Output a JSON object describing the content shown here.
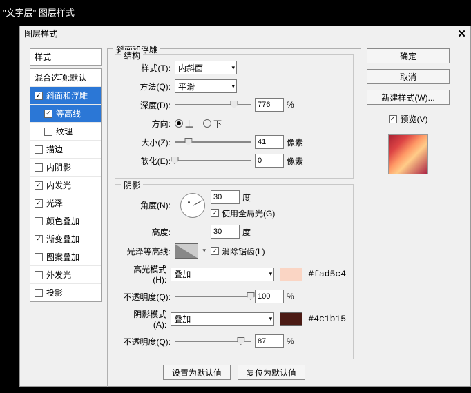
{
  "outer_title": "\"文字层\" 图层样式",
  "dialog": {
    "title": "图层样式",
    "close": "✕"
  },
  "left": {
    "styles_header": "样式",
    "blend_options": "混合选项:默认",
    "bevel": "斜面和浮雕",
    "contour": "等高线",
    "texture": "纹理",
    "stroke": "描边",
    "inner_shadow": "内阴影",
    "inner_glow": "内发光",
    "satin": "光泽",
    "color_overlay": "颜色叠加",
    "gradient_overlay": "渐变叠加",
    "pattern_overlay": "图案叠加",
    "outer_glow": "外发光",
    "drop_shadow": "投影"
  },
  "bevel": {
    "section": "斜面和浮雕",
    "structure_legend": "结构",
    "style_label": "样式(T):",
    "style_value": "内斜面",
    "technique_label": "方法(Q):",
    "technique_value": "平滑",
    "depth_label": "深度(D):",
    "depth_value": "776",
    "percent": "%",
    "direction_label": "方向:",
    "dir_up": "上",
    "dir_down": "下",
    "size_label": "大小(Z):",
    "size_value": "41",
    "px": "像素",
    "soften_label": "软化(E):",
    "soften_value": "0"
  },
  "shading": {
    "legend": "阴影",
    "angle_label": "角度(N):",
    "angle_value": "30",
    "deg": "度",
    "global_light": "使用全局光(G)",
    "altitude_label": "高度:",
    "altitude_value": "30",
    "gloss_contour_label": "光泽等高线:",
    "antialias": "消除锯齿(L)",
    "highlight_mode_label": "高光模式(H):",
    "highlight_mode_value": "叠加",
    "highlight_opacity_label": "不透明度(Q):",
    "highlight_opacity_value": "100",
    "highlight_hex": "#fad5c4",
    "shadow_mode_label": "阴影模式(A):",
    "shadow_mode_value": "叠加",
    "shadow_opacity_label": "不透明度(Q):",
    "shadow_opacity_value": "87",
    "shadow_hex": "#4c1b15"
  },
  "footer": {
    "make_default": "设置为默认值",
    "reset_default": "复位为默认值"
  },
  "right": {
    "ok": "确定",
    "cancel": "取消",
    "new_style": "新建样式(W)...",
    "preview": "预览(V)"
  },
  "colors": {
    "highlight": "#fad5c4",
    "shadow": "#4c1b15"
  }
}
